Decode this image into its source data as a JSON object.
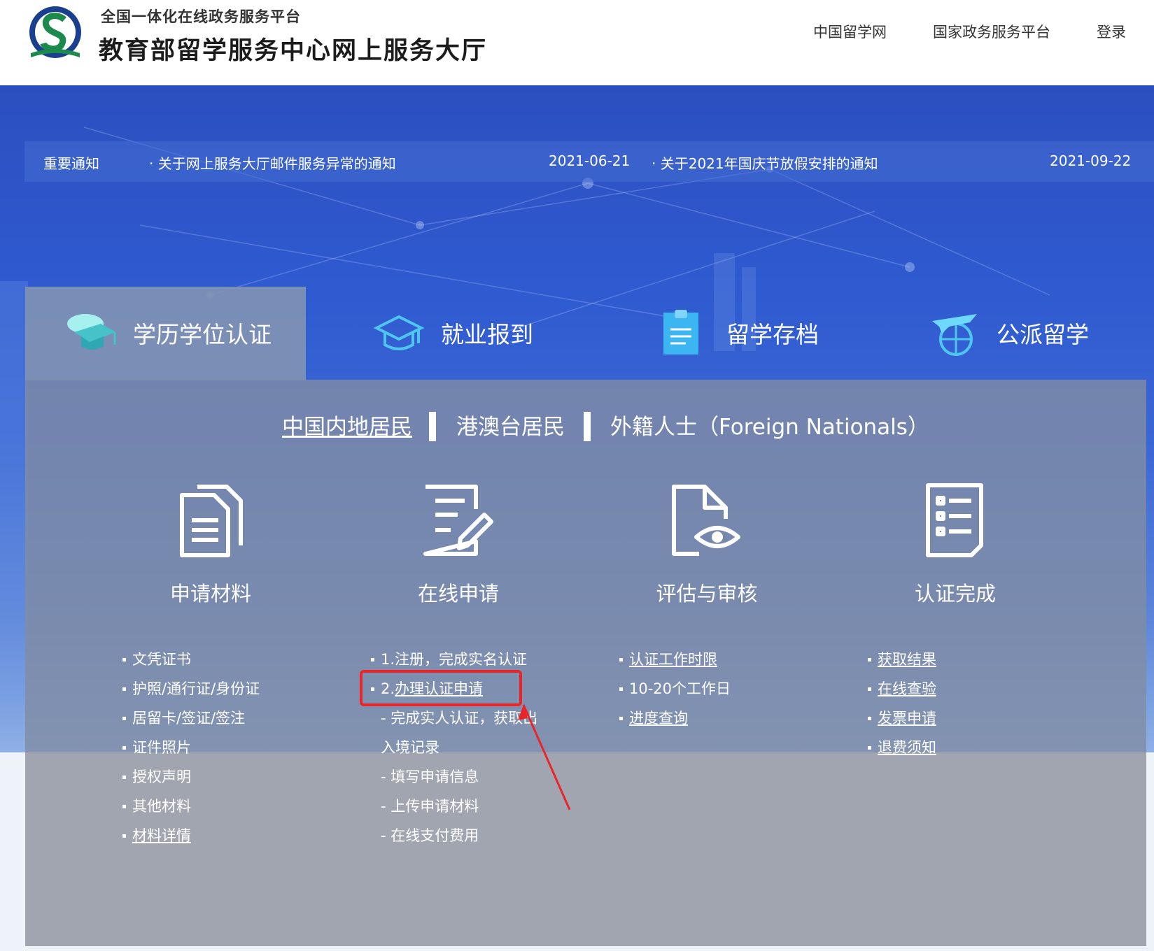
{
  "header": {
    "subtitle": "全国一体化在线政务服务平台",
    "title": "教育部留学服务中心网上服务大厅",
    "nav": [
      "中国留学网",
      "国家政务服务平台",
      "登录"
    ]
  },
  "notice": {
    "label": "重要通知",
    "items": [
      {
        "title": "关于网上服务大厅邮件服务异常的通知",
        "date": "2021-06-21"
      },
      {
        "title": "关于2021年国庆节放假安排的通知",
        "date": "2021-09-22"
      }
    ]
  },
  "categories": [
    "学历学位认证",
    "就业报到",
    "留学存档",
    "公派留学"
  ],
  "subtabs": [
    "中国内地居民",
    "港澳台居民",
    "外籍人士（Foreign Nationals）"
  ],
  "steps": [
    {
      "title": "申请材料",
      "items": [
        "文凭证书",
        "护照/通行证/身份证",
        "居留卡/签证/签注",
        "证件照片",
        "授权声明",
        "其他材料",
        "材料详情"
      ]
    },
    {
      "title": "在线申请",
      "items": [
        "1.注册，完成实名认证",
        "2.",
        "办理认证申请",
        "- 完成实人认证，获取出",
        "入境记录",
        "- 填写申请信息",
        "- 上传申请材料",
        "- 在线支付费用"
      ]
    },
    {
      "title": "评估与审核",
      "items": [
        "认证工作时限",
        "10-20个工作日",
        "进度查询"
      ]
    },
    {
      "title": "认证完成",
      "items": [
        "获取结果",
        "在线查验",
        "发票申请",
        "退费须知"
      ]
    }
  ],
  "colors": {
    "highlight": "#e8262a",
    "hero": "#2f5ad0",
    "panel": "#808ca5"
  }
}
